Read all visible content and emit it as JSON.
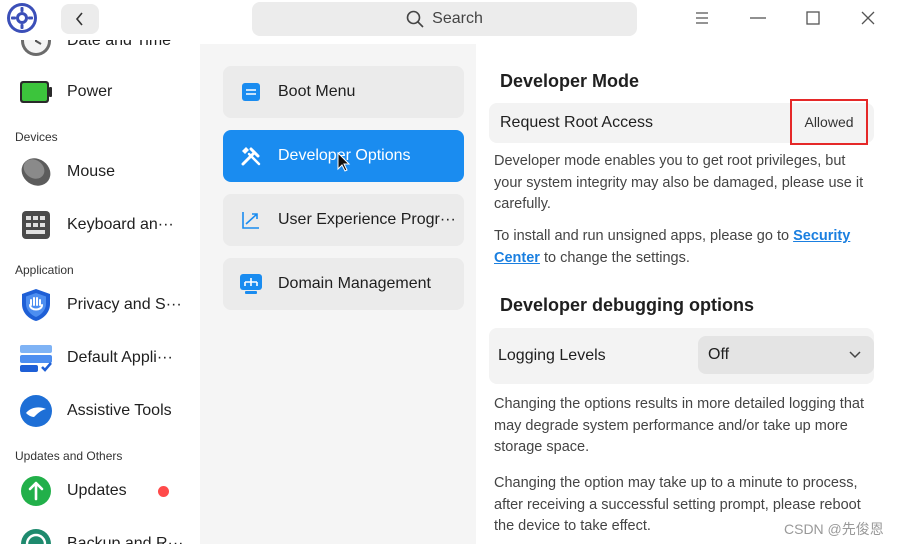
{
  "titlebar": {
    "search_placeholder": "Search"
  },
  "sidebar": {
    "items": [
      {
        "label": "Date and Time",
        "icon": "clock-icon"
      },
      {
        "label": "Power",
        "icon": "battery-icon"
      },
      {
        "label": "Mouse",
        "icon": "mouse-icon"
      },
      {
        "label": "Keyboard an···",
        "icon": "keyboard-icon"
      },
      {
        "label": "Privacy and S···",
        "icon": "shield-icon"
      },
      {
        "label": "Default Appli···",
        "icon": "default-apps-icon"
      },
      {
        "label": "Assistive Tools",
        "icon": "assistive-icon"
      },
      {
        "label": "Updates",
        "icon": "updates-icon"
      },
      {
        "label": "Backup and R···",
        "icon": "backup-icon"
      }
    ],
    "sections": {
      "devices": "Devices",
      "application": "Application",
      "updates_others": "Updates and Others"
    }
  },
  "middle": {
    "items": [
      {
        "label": "Boot Menu",
        "icon": "boot-menu-icon"
      },
      {
        "label": "Developer Options",
        "icon": "tools-icon"
      },
      {
        "label": "User Experience Progr···",
        "icon": "chart-icon"
      },
      {
        "label": "Domain Management",
        "icon": "domain-icon"
      }
    ]
  },
  "content": {
    "developer_mode_title": "Developer Mode",
    "root_access_label": "Request Root Access",
    "root_access_value": "Allowed",
    "dev_mode_desc": "Developer mode enables you to get root privileges, but your system integrity may also be damaged, please use it carefully.",
    "install_text_before": "To install and run unsigned apps, please go to ",
    "install_link_1": "Security",
    "install_link_2": "Center",
    "install_text_after": " to change the settings.",
    "debug_title": "Developer debugging options",
    "logging_label": "Logging Levels",
    "logging_value": "Off",
    "logging_desc_1": "Changing the options results in more detailed logging that may degrade system performance and/or take up more storage space.",
    "logging_desc_2": "Changing the option may take up to a minute to process, after receiving a successful setting prompt, please reboot the device to take effect."
  },
  "watermark": "CSDN @先俊恩",
  "colors": {
    "accent": "#1a8cf0",
    "highlight_border": "#e52828",
    "badge": "#ff4a4a"
  }
}
